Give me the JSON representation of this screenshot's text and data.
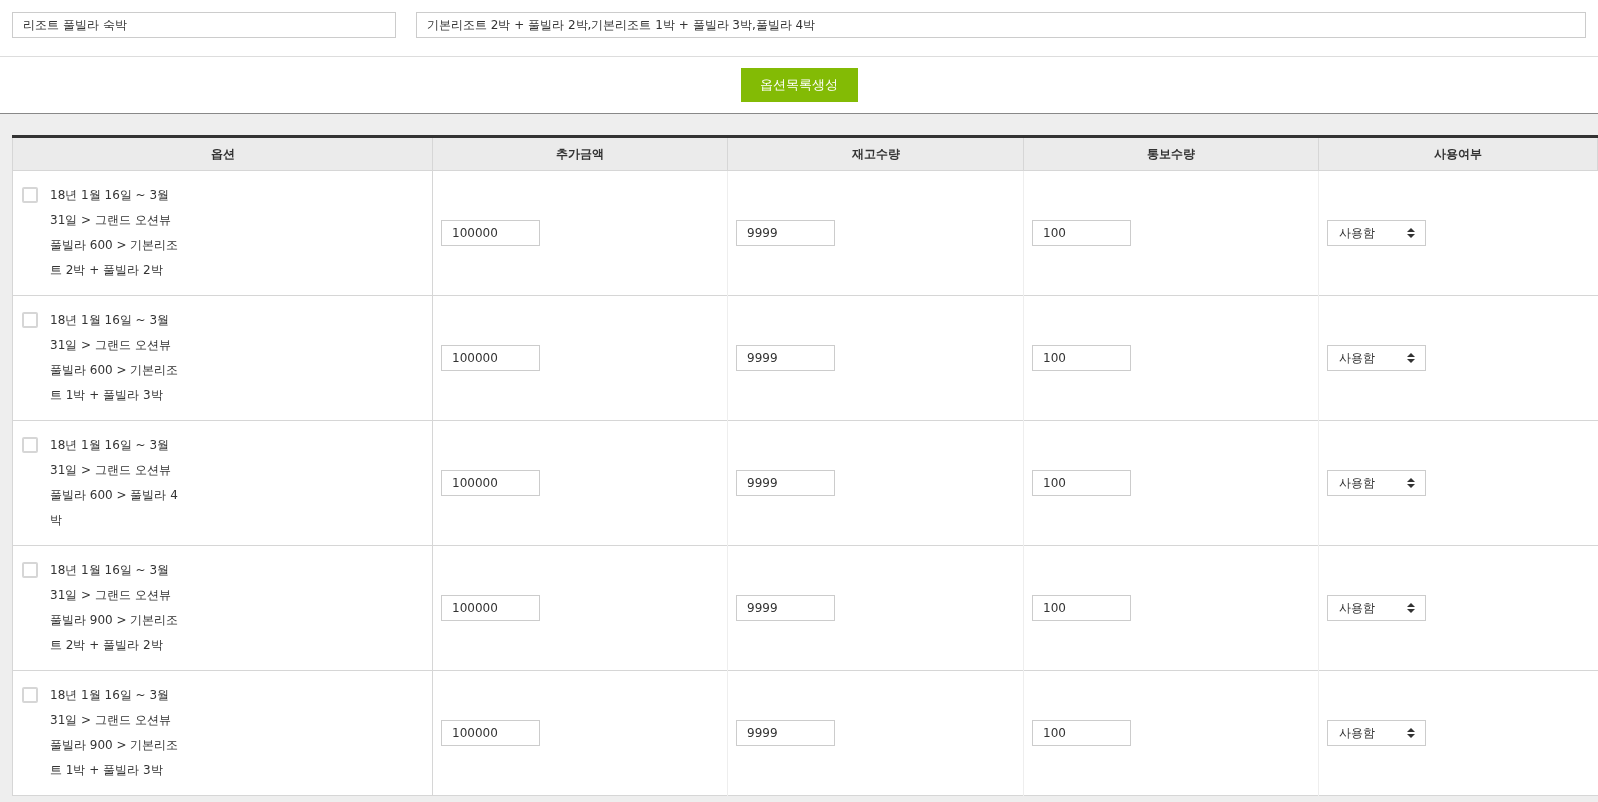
{
  "fields": [
    {
      "value": "리조트 풀빌라 숙박"
    },
    {
      "value": "기본리조트 2박 + 풀빌라 2박,기본리조트 1박 + 풀빌라 3박,풀빌라 4박"
    }
  ],
  "generate_button": "옵션목록생성",
  "table": {
    "columns": [
      "옵션",
      "추가금액",
      "재고수량",
      "통보수량",
      "사용여부"
    ],
    "rows": [
      {
        "checked": false,
        "option": "18년 1월 16일 ~ 3월 31일 > 그랜드 오션뷰 풀빌라 600 > 기본리조트 2박 + 풀빌라 2박",
        "price": "100000",
        "stock": "9999",
        "notify": "100",
        "use": "사용함"
      },
      {
        "checked": false,
        "option": "18년 1월 16일 ~ 3월 31일 > 그랜드 오션뷰 풀빌라 600 > 기본리조트 1박 + 풀빌라 3박",
        "price": "100000",
        "stock": "9999",
        "notify": "100",
        "use": "사용함"
      },
      {
        "checked": false,
        "option": "18년 1월 16일 ~ 3월 31일 > 그랜드 오션뷰 풀빌라 600 > 풀빌라 4박",
        "price": "100000",
        "stock": "9999",
        "notify": "100",
        "use": "사용함"
      },
      {
        "checked": false,
        "option": "18년 1월 16일 ~ 3월 31일 > 그랜드 오션뷰 풀빌라 900 > 기본리조트 2박 + 풀빌라 2박",
        "price": "100000",
        "stock": "9999",
        "notify": "100",
        "use": "사용함"
      },
      {
        "checked": false,
        "option": "18년 1월 16일 ~ 3월 31일 > 그랜드 오션뷰 풀빌라 900 > 기본리조트 1박 + 풀빌라 3박",
        "price": "100000",
        "stock": "9999",
        "notify": "100",
        "use": "사용함"
      }
    ]
  }
}
